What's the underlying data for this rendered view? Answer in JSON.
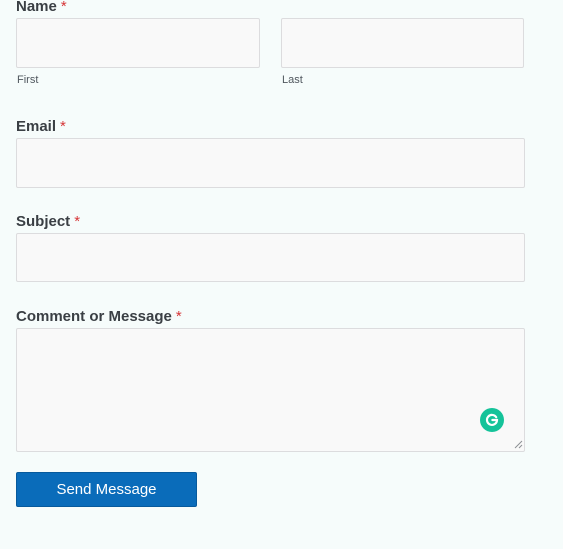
{
  "form": {
    "name": {
      "label": "Name",
      "required_mark": "*",
      "first_value": "",
      "last_value": "",
      "first_sublabel": "First",
      "last_sublabel": "Last"
    },
    "email": {
      "label": "Email",
      "required_mark": "*",
      "value": ""
    },
    "subject": {
      "label": "Subject",
      "required_mark": "*",
      "value": ""
    },
    "message": {
      "label": "Comment or Message",
      "required_mark": "*",
      "value": ""
    },
    "submit_label": "Send Message"
  },
  "icons": {
    "grammarly": "grammarly-icon",
    "resize": "resize-grip-icon"
  },
  "colors": {
    "required": "#d63638",
    "button": "#0a6cba",
    "grammarly": "#15c39a",
    "background": "#f6fcfb"
  }
}
